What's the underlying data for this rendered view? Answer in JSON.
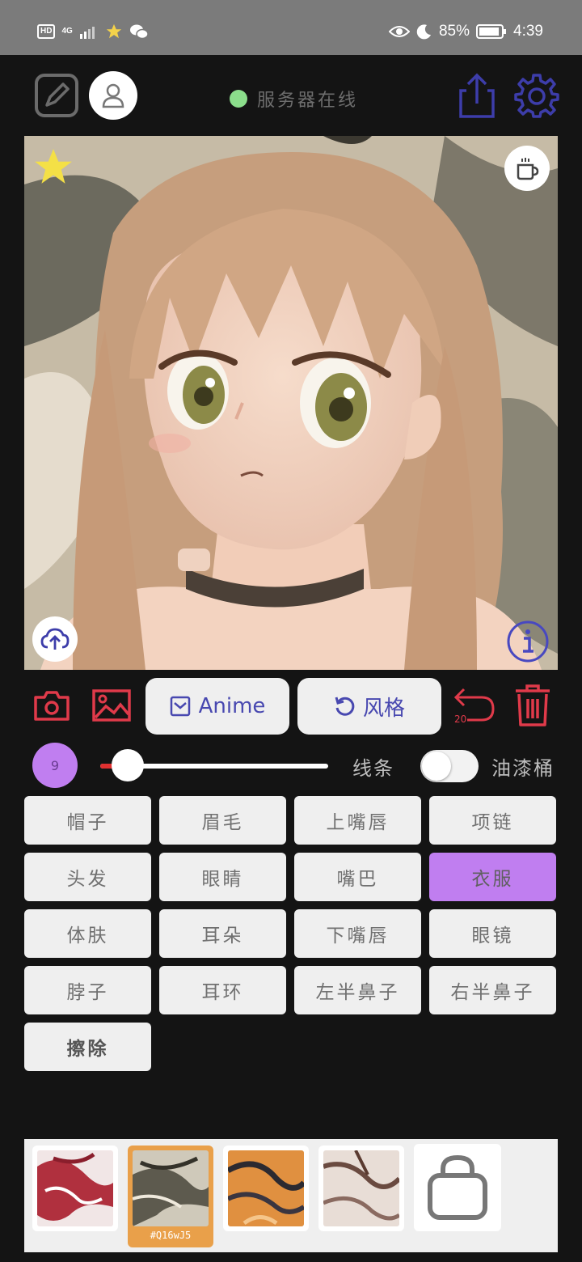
{
  "status_bar": {
    "hd": "HD",
    "network": "4G",
    "battery": "85%",
    "time": "4:39"
  },
  "header": {
    "server_status": "服务器在线",
    "server_status_color": "#8bde8b"
  },
  "actions": {
    "anime_label": "Anime",
    "style_label": "风格",
    "undo_count": "20"
  },
  "controls": {
    "brush_size": "9",
    "line_label": "线条",
    "paint_bucket_label": "油漆桶",
    "slider_value": 0.12,
    "paint_bucket_on": false
  },
  "labels": [
    [
      "帽子",
      "眉毛",
      "上嘴唇",
      "项链"
    ],
    [
      "头发",
      "眼睛",
      "嘴巴",
      "衣服"
    ],
    [
      "体肤",
      "耳朵",
      "下嘴唇",
      "眼镜"
    ],
    [
      "脖子",
      "耳环",
      "左半鼻子",
      "右半鼻子"
    ],
    [
      "擦除"
    ]
  ],
  "active_label": "衣服",
  "styles": {
    "selected_code": "#Q16wJ5"
  },
  "colors": {
    "accent": "#4848b0",
    "danger": "#e03a4a",
    "active_tag": "#c07ef0"
  }
}
